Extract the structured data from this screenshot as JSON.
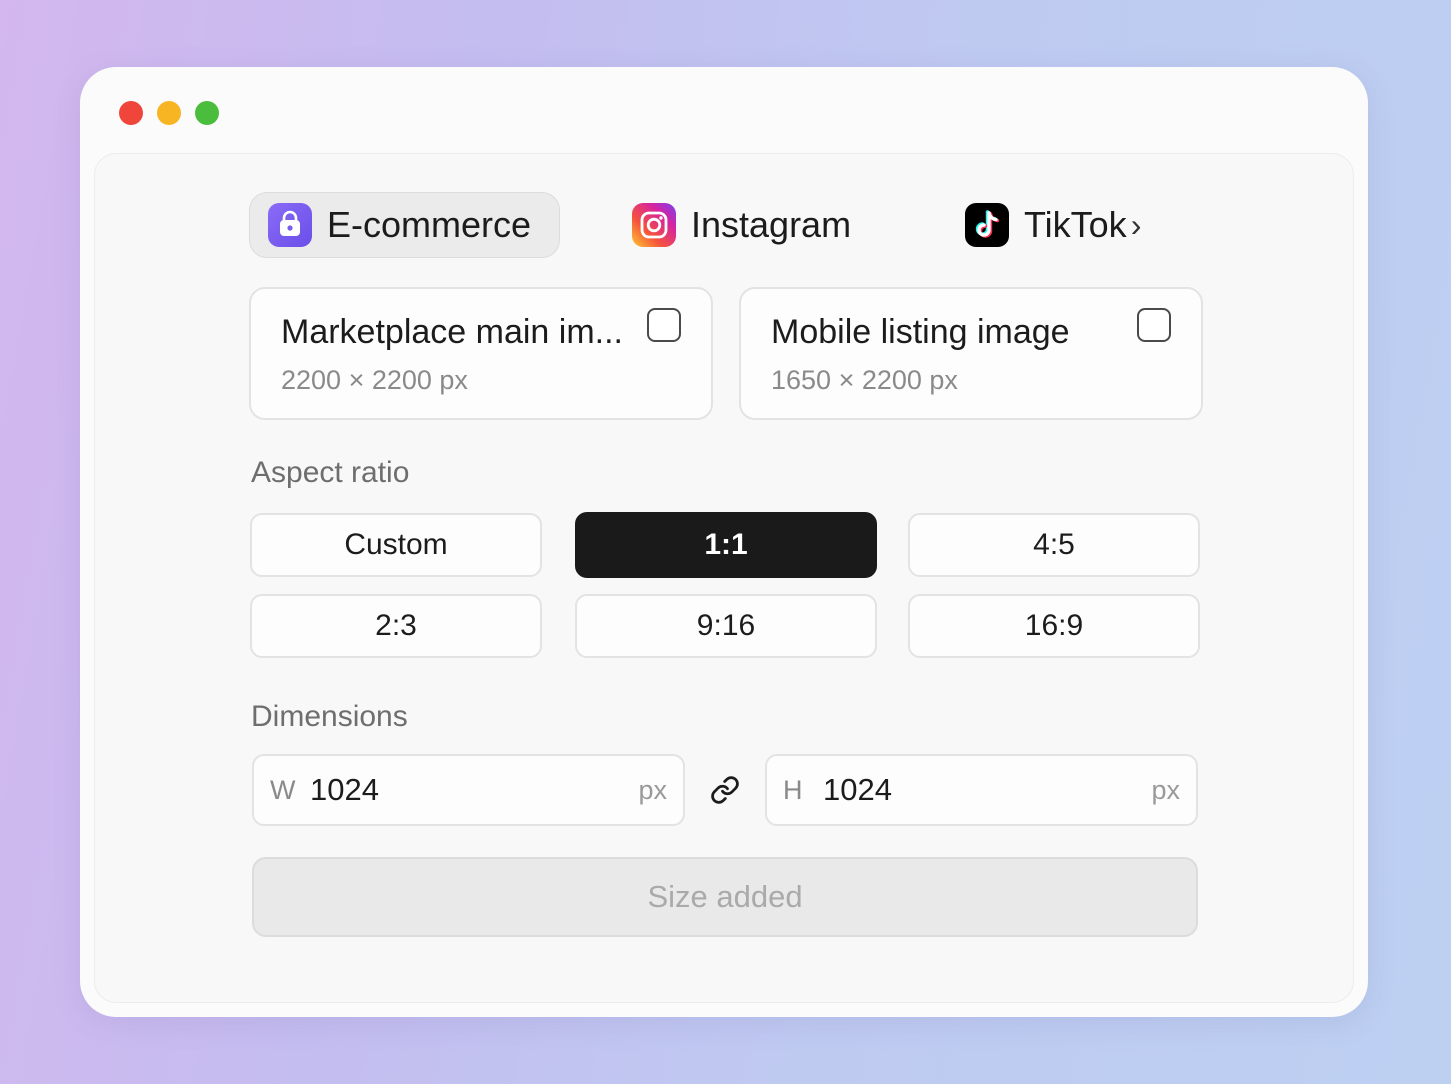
{
  "window": {
    "controls": [
      "close",
      "minimize",
      "maximize"
    ]
  },
  "tabs": [
    {
      "label": "E-commerce",
      "icon": "shopping-bag-icon",
      "active": true
    },
    {
      "label": "Instagram",
      "icon": "instagram-icon",
      "active": false
    },
    {
      "label": "TikTok",
      "icon": "tiktok-icon",
      "active": false,
      "more": "›"
    }
  ],
  "presets": [
    {
      "title": "Marketplace main im...",
      "size": "2200 × 2200 px",
      "checked": false
    },
    {
      "title": "Mobile listing image",
      "size": "1650 × 2200 px",
      "checked": false
    }
  ],
  "aspect": {
    "label": "Aspect ratio",
    "options": [
      "Custom",
      "1:1",
      "4:5",
      "2:3",
      "9:16",
      "16:9"
    ],
    "selected": "1:1"
  },
  "dimensions": {
    "label": "Dimensions",
    "width": {
      "prefix": "W",
      "value": "1024",
      "unit": "px"
    },
    "height": {
      "prefix": "H",
      "value": "1024",
      "unit": "px"
    },
    "link_icon": "link-icon"
  },
  "submit": {
    "label": "Size added",
    "disabled": true
  },
  "colors": {
    "accent_purple": "#7a5cf0",
    "selected_bg": "#1a1a1a",
    "traffic_red": "#f0453a",
    "traffic_yellow": "#f7b523",
    "traffic_green": "#4bbd3c"
  }
}
